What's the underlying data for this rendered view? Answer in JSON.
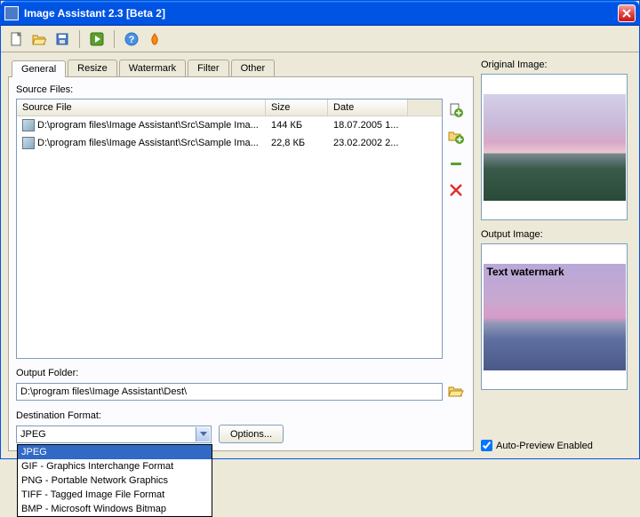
{
  "title": "Image Assistant 2.3 [Beta 2]",
  "tabs": [
    "General",
    "Resize",
    "Watermark",
    "Filter",
    "Other"
  ],
  "activeTab": 0,
  "sourceFilesLabel": "Source Files:",
  "columns": {
    "file": "Source File",
    "size": "Size",
    "date": "Date"
  },
  "files": [
    {
      "path": "D:\\program files\\Image Assistant\\Src\\Sample Ima...",
      "size": "144 КБ",
      "date": "18.07.2005 1..."
    },
    {
      "path": "D:\\program files\\Image Assistant\\Src\\Sample Ima...",
      "size": "22,8 КБ",
      "date": "23.02.2002 2..."
    }
  ],
  "outputFolderLabel": "Output Folder:",
  "outputFolder": "D:\\program files\\Image Assistant\\Dest\\",
  "destFormatLabel": "Destination Format:",
  "destFormatValue": "JPEG",
  "optionsLabel": "Options...",
  "formatOptions": [
    "JPEG",
    "GIF - Graphics Interchange Format",
    "PNG - Portable Network Graphics",
    "TIFF - Tagged Image File Format",
    "BMP - Microsoft Windows Bitmap"
  ],
  "originalImageLabel": "Original Image:",
  "outputImageLabel": "Output Image:",
  "watermarkText": "Text watermark",
  "autoPreviewLabel": "Auto-Preview Enabled",
  "autoPreviewChecked": true
}
